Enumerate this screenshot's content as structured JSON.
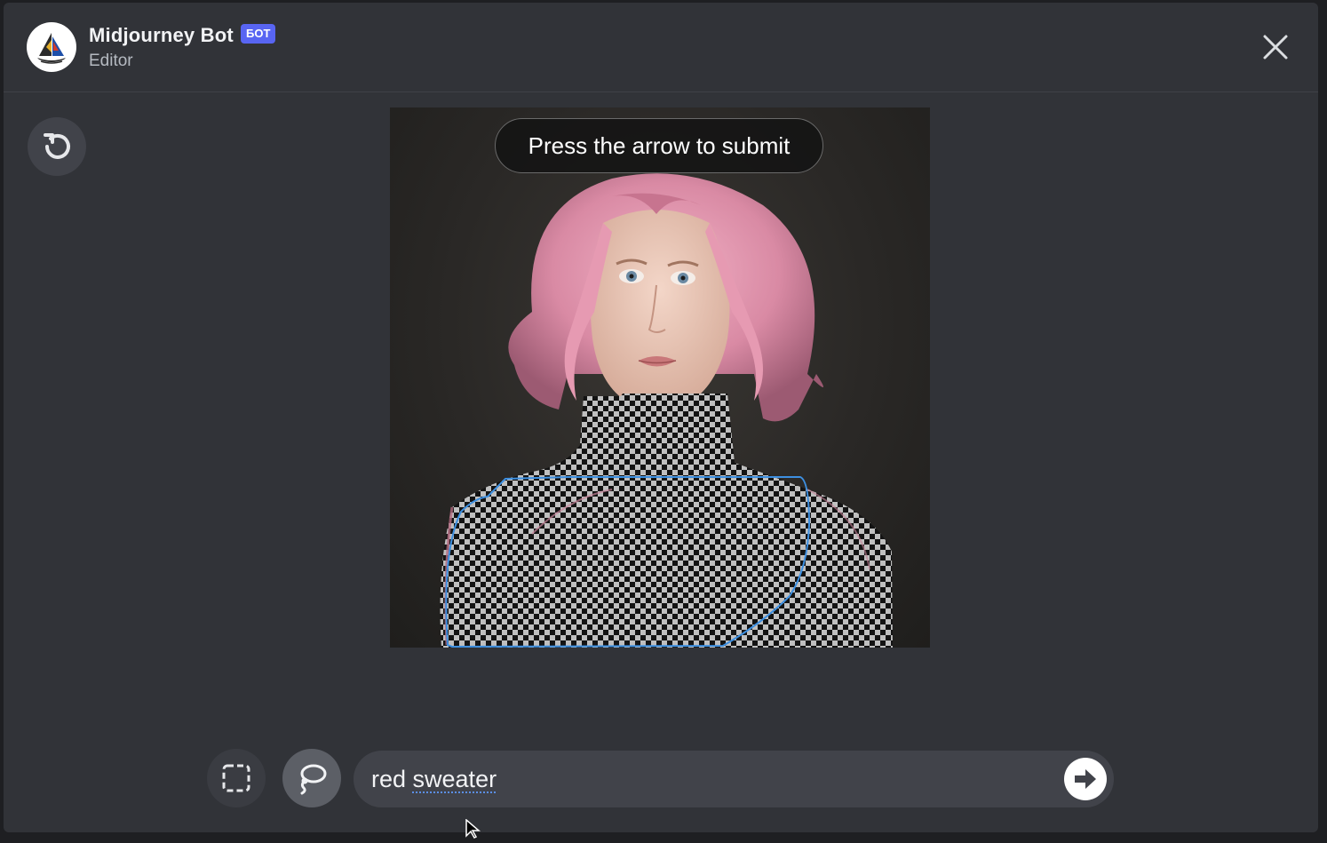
{
  "header": {
    "bot_name": "Midjourney Bot",
    "badge": "БОТ",
    "subtitle": "Editor",
    "avatar_icon": "sailboat-logo-icon",
    "close_icon": "close-icon"
  },
  "editor": {
    "undo_icon": "undo-icon",
    "tooltip": "Press the arrow to submit",
    "image_description": "portrait-with-masked-region",
    "selection_color": "#3d8fe0"
  },
  "toolbar": {
    "rect_select_icon": "rectangle-select-icon",
    "lasso_icon": "lasso-icon",
    "lasso_active": true,
    "prompt_value": "red sweater",
    "prompt_word_1": "red ",
    "prompt_word_2": "sweater",
    "submit_icon": "arrow-right-icon"
  },
  "colors": {
    "modal_bg": "#313338",
    "badge_bg": "#5865f2",
    "input_bg": "#41434a",
    "spellcheck_underline": "#5b8fe8"
  }
}
